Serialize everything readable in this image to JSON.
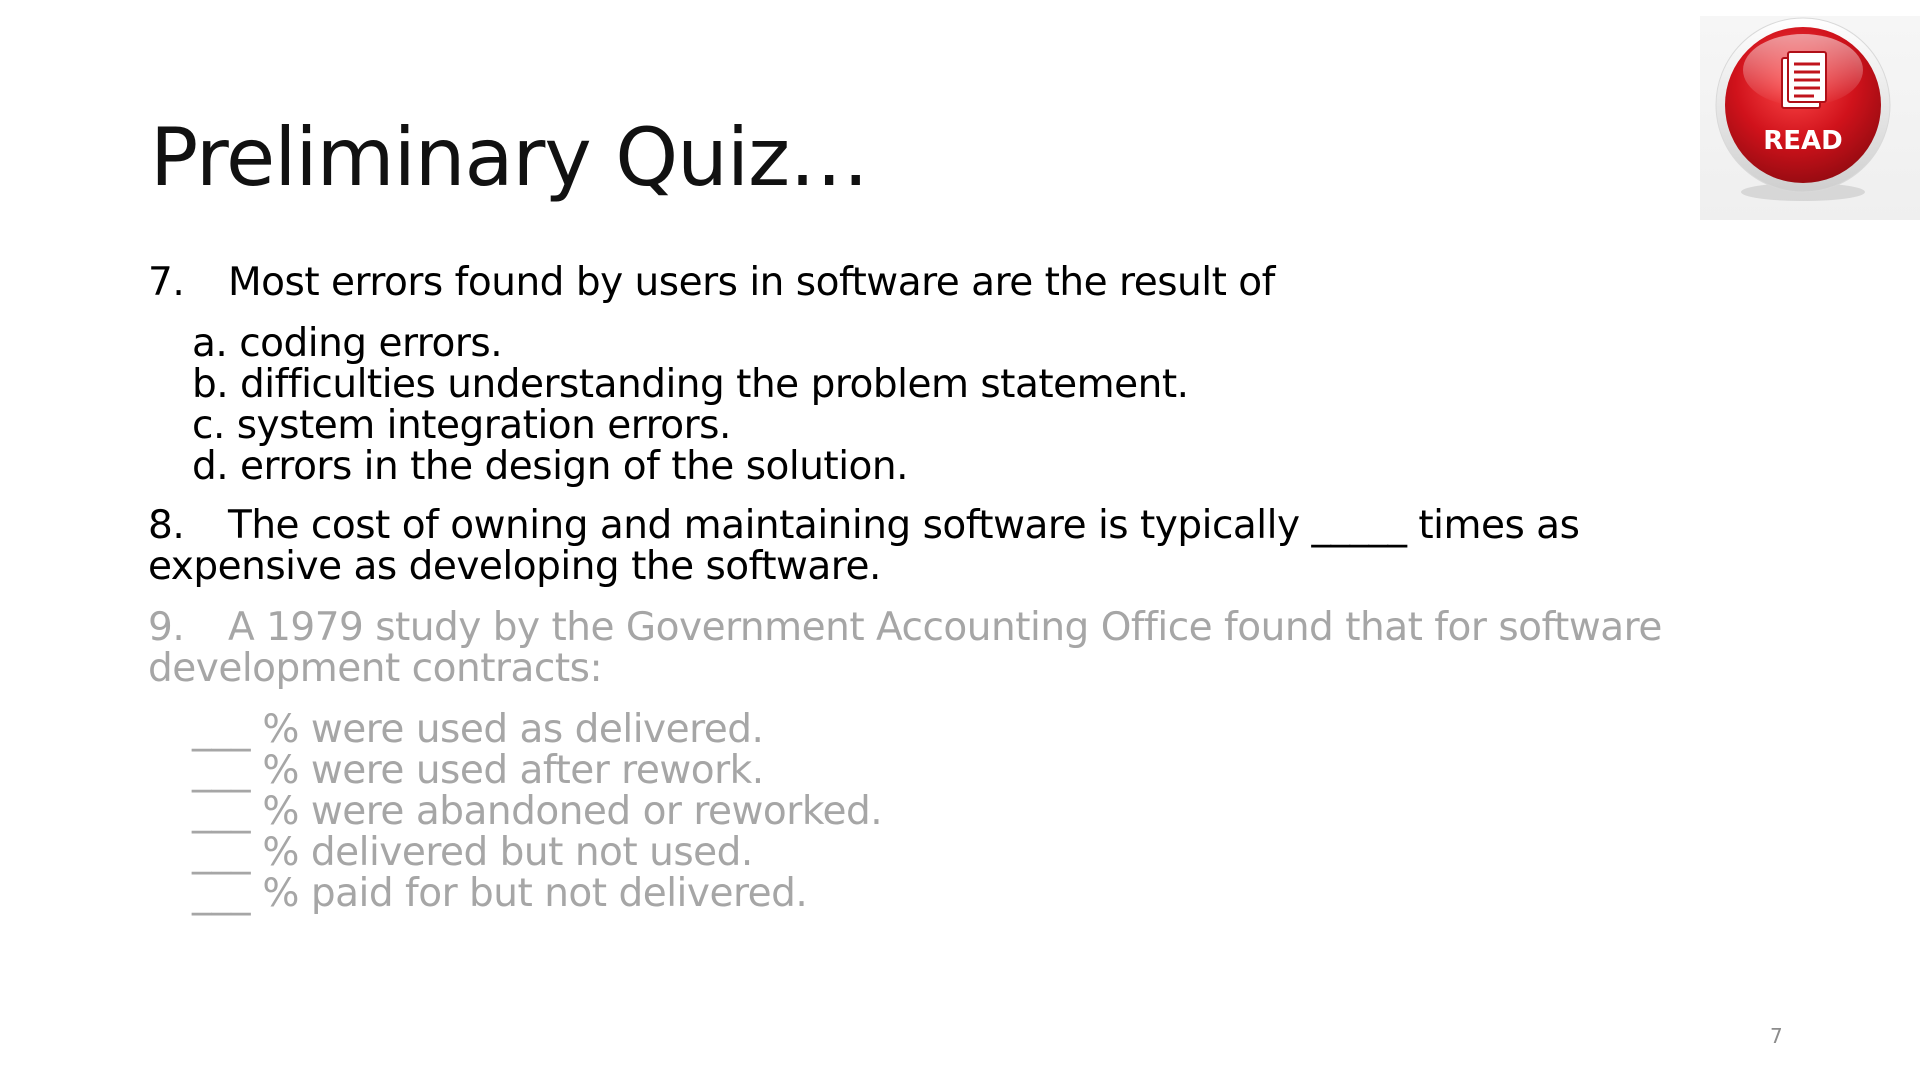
{
  "slide": {
    "title": "Preliminary Quiz…",
    "page_number": "7",
    "badge": {
      "label": "READ",
      "icon": "document-icon",
      "color": "#d0121b"
    }
  },
  "questions": [
    {
      "number": "7.",
      "text": "Most errors found by users in software are the result of",
      "options": [
        "a. coding errors.",
        "b. difficulties understanding the problem statement.",
        "c. system integration errors.",
        "d. errors in the design of the solution."
      ]
    },
    {
      "number": "8.",
      "text_line1": "The cost of owning and maintaining software is typically _____ times as",
      "text_line2": "expensive as developing the software."
    },
    {
      "number": "9.",
      "text_line1": "A 1979 study by the Government Accounting Office found that for software",
      "text_line2": "development contracts:",
      "blank": "___",
      "items": [
        "% were used as delivered.",
        "% were used after rework.",
        "% were abandoned or reworked.",
        "% delivered but not used.",
        "% paid for but not delivered."
      ]
    }
  ],
  "colors": {
    "muted_text": "#a6a6a6",
    "badge_red": "#d0121b"
  }
}
